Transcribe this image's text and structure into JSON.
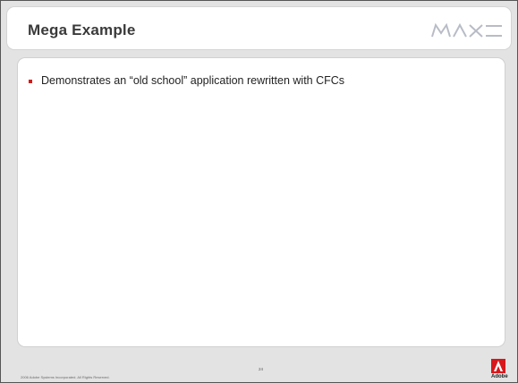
{
  "slide": {
    "title": "Mega Example",
    "brand_logo": "MAX",
    "bullets": [
      "Demonstrates an “old school” application rewritten with CFCs"
    ],
    "footer_copyright": "2006 Adobe Systems Incorporated. All Rights Reserved.",
    "page_number": "24",
    "corporate_logo": "Adobe"
  },
  "colors": {
    "bullet": "#d01b1b",
    "adobe_red": "#d7181c",
    "title_text": "#3a3a3a"
  }
}
